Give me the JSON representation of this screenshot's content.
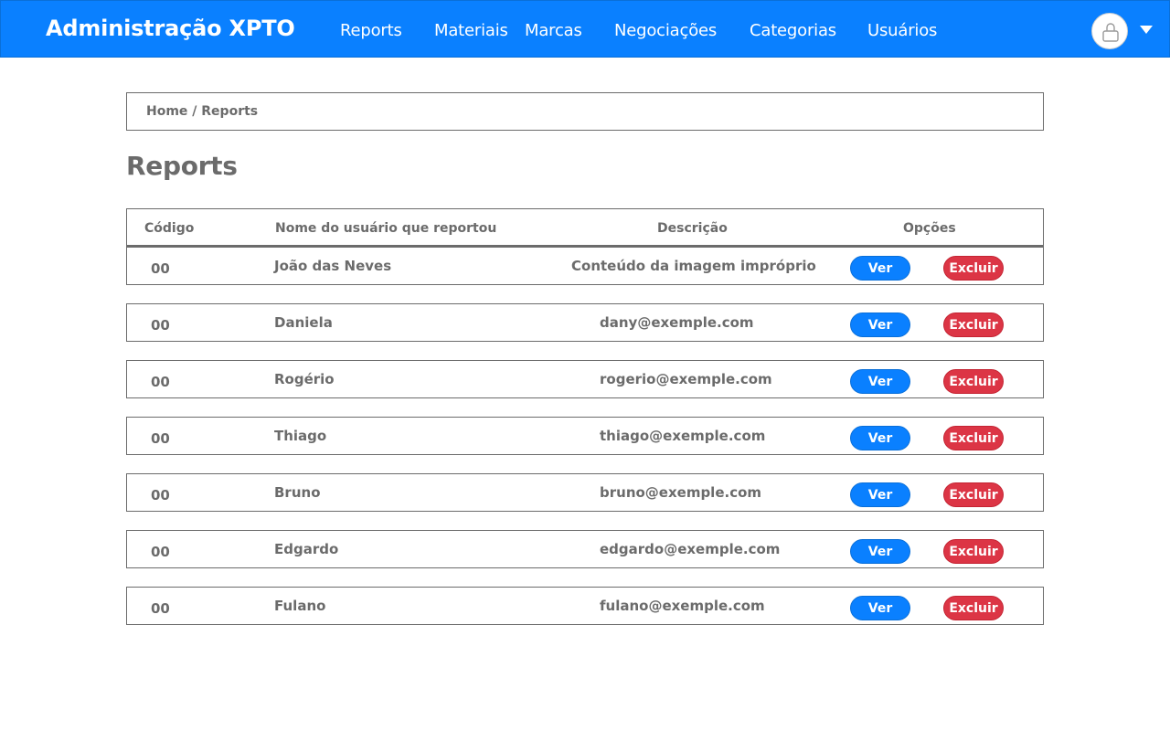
{
  "navbar": {
    "brand": "Administração XPTO",
    "items": [
      "Reports",
      "Materiais",
      "Marcas",
      "Negociações",
      "Categorias",
      "Usuários"
    ]
  },
  "breadcrumb": "Home / Reports",
  "page_title": "Reports",
  "table": {
    "headers": [
      "Código",
      "Nome do usuário que reportou",
      "Descrição",
      "Opções"
    ],
    "rows": [
      {
        "code": "00",
        "name": "João das Neves",
        "desc": "Conteúdo da imagem impróprio"
      },
      {
        "code": "00",
        "name": "Daniela",
        "desc": "dany@exemple.com"
      },
      {
        "code": "00",
        "name": "Rogério",
        "desc": "rogerio@exemple.com"
      },
      {
        "code": "00",
        "name": "Thiago",
        "desc": "thiago@exemple.com"
      },
      {
        "code": "00",
        "name": "Bruno",
        "desc": "bruno@exemple.com"
      },
      {
        "code": "00",
        "name": "Edgardo",
        "desc": "edgardo@exemple.com"
      },
      {
        "code": "00",
        "name": "Fulano",
        "desc": "fulano@exemple.com"
      }
    ],
    "view_label": "Ver",
    "delete_label": "Excluir"
  },
  "colors": {
    "primary": "#0a80ff",
    "danger": "#dc3545",
    "text": "#6b6b6b"
  },
  "icons": {
    "avatar": "user-lock-icon",
    "dropdown": "caret-down-icon"
  }
}
